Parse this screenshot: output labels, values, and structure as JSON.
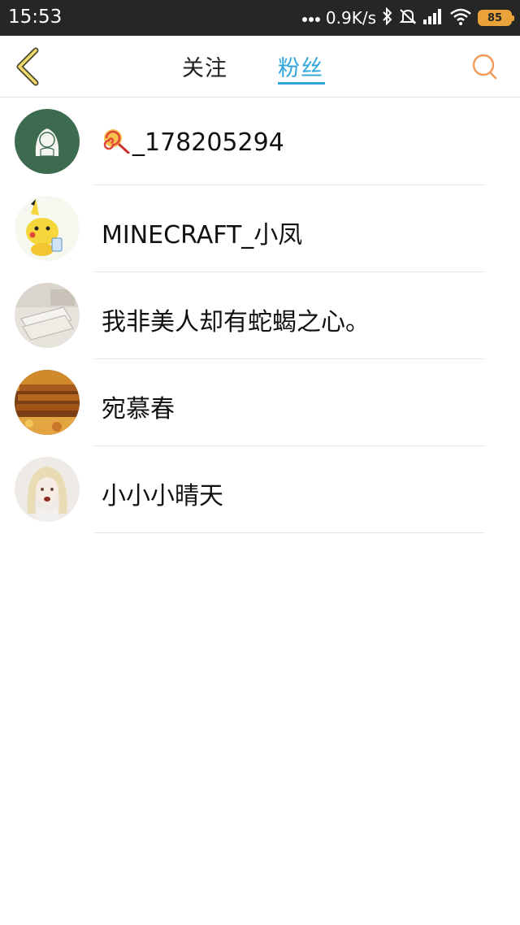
{
  "status_bar": {
    "time": "15:53",
    "network_speed": "0.9K/s",
    "battery": "85",
    "icons": [
      "dots-icon",
      "bluetooth-icon",
      "mute-bell-icon",
      "signal-icon",
      "wifi-icon",
      "battery-icon"
    ]
  },
  "header": {
    "tabs": [
      {
        "label": "关注",
        "active": false
      },
      {
        "label": "粉丝",
        "active": true
      }
    ],
    "accent_color": "#2fa5dc",
    "back_icon": "chevron-left-icon",
    "search_icon": "search-icon"
  },
  "fans": [
    {
      "name": "_178205294",
      "prefix_icon": "lollipop-icon",
      "avatar": "green-sketch-avatar"
    },
    {
      "name": "MINECRAFT_小凤",
      "avatar": "pikachu-avatar"
    },
    {
      "name": "我非美人却有蛇蝎之心。",
      "avatar": "books-avatar"
    },
    {
      "name": "宛慕春",
      "avatar": "bench-avatar"
    },
    {
      "name": "小小小晴天",
      "avatar": "anime-girl-avatar"
    }
  ]
}
